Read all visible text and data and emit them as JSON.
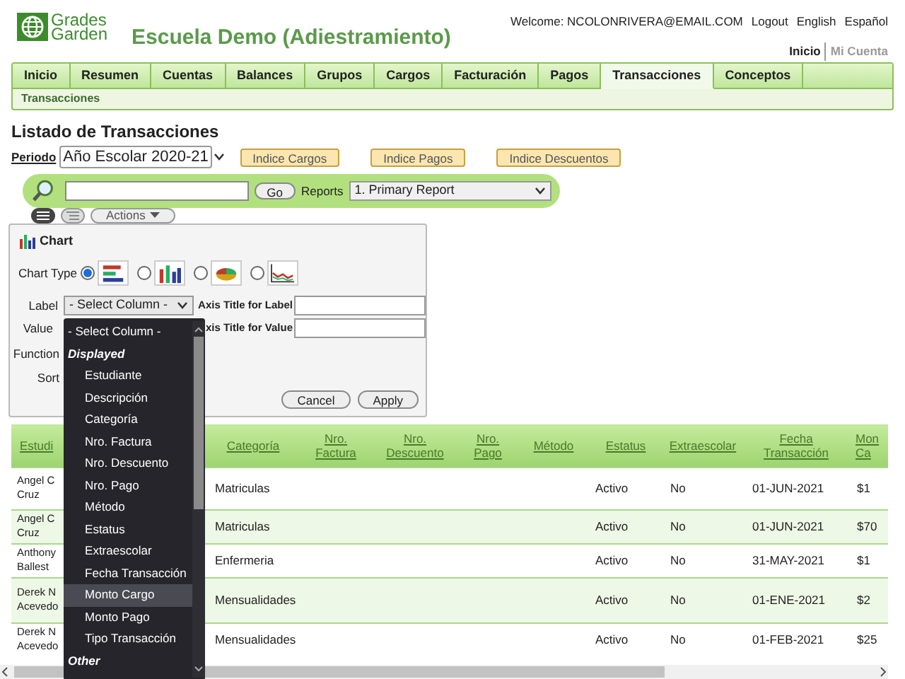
{
  "header": {
    "logo_top": "Grades",
    "logo_bottom": "Garden",
    "school": "Escuela Demo (Adiestramiento)",
    "welcome": "Welcome: NCOLONRIVERA@EMAIL.COM",
    "links": [
      "Logout",
      "English",
      "Español"
    ],
    "account_links": [
      {
        "label": "Inicio",
        "selected": true
      },
      {
        "label": "Mi Cuenta",
        "selected": false
      }
    ]
  },
  "nav": {
    "tabs": [
      {
        "label": "Inicio",
        "selected": false
      },
      {
        "label": "Resumen",
        "selected": false
      },
      {
        "label": "Cuentas",
        "selected": false
      },
      {
        "label": "Balances",
        "selected": false
      },
      {
        "label": "Grupos",
        "selected": false
      },
      {
        "label": "Cargos",
        "selected": false
      },
      {
        "label": "Facturación",
        "selected": false
      },
      {
        "label": "Pagos",
        "selected": false
      },
      {
        "label": "Transacciones",
        "selected": true
      },
      {
        "label": "Conceptos",
        "selected": false
      }
    ],
    "subtab": "Transacciones"
  },
  "page_title": "Listado de Transacciones",
  "period": {
    "label": "Periodo",
    "value": "Año Escolar 2020-21"
  },
  "index_buttons": [
    "Indice Cargos",
    "Indice Pagos",
    "Indice Descuentos"
  ],
  "search": {
    "go": "Go",
    "reports_label": "Reports",
    "report": "1. Primary Report"
  },
  "toolbar": {
    "actions": "Actions"
  },
  "chart_panel": {
    "title": "Chart",
    "chart_type_label": "Chart Type",
    "chart_types": [
      {
        "kind": "bar_horizontal",
        "selected": true
      },
      {
        "kind": "bar_vertical",
        "selected": false
      },
      {
        "kind": "pie",
        "selected": false
      },
      {
        "kind": "line",
        "selected": false
      }
    ],
    "label_row": {
      "label": "Label",
      "select": "- Select Column -",
      "axis_label": "Axis Title for Label"
    },
    "value_row": {
      "label": "Value",
      "axis_label": "xis Title for Value"
    },
    "function_label": "Function",
    "sort_label": "Sort",
    "buttons": [
      "Cancel",
      "Apply"
    ]
  },
  "dropdown": {
    "items": [
      {
        "kind": "option",
        "label": "- Select Column -",
        "highlighted": false
      },
      {
        "kind": "group",
        "label": "Displayed",
        "highlighted": false
      },
      {
        "kind": "sub",
        "label": "Estudiante",
        "highlighted": false
      },
      {
        "kind": "sub",
        "label": "Descripción",
        "highlighted": false
      },
      {
        "kind": "sub",
        "label": "Categoría",
        "highlighted": false
      },
      {
        "kind": "sub",
        "label": "Nro. Factura",
        "highlighted": false
      },
      {
        "kind": "sub",
        "label": "Nro. Descuento",
        "highlighted": false
      },
      {
        "kind": "sub",
        "label": "Nro. Pago",
        "highlighted": false
      },
      {
        "kind": "sub",
        "label": "Método",
        "highlighted": false
      },
      {
        "kind": "sub",
        "label": "Estatus",
        "highlighted": false
      },
      {
        "kind": "sub",
        "label": "Extraescolar",
        "highlighted": false
      },
      {
        "kind": "sub",
        "label": "Fecha Transacción",
        "highlighted": false
      },
      {
        "kind": "sub",
        "label": "Monto Cargo",
        "highlighted": true
      },
      {
        "kind": "sub",
        "label": "Monto Pago",
        "highlighted": false
      },
      {
        "kind": "sub",
        "label": "Tipo Transacción",
        "highlighted": false
      },
      {
        "kind": "group",
        "label": "Other",
        "highlighted": false
      }
    ]
  },
  "table": {
    "columns": [
      [
        "Estudi"
      ],
      [],
      [
        "Categoría"
      ],
      [
        "Nro.",
        "Factura"
      ],
      [
        "Nro.",
        "Descuento"
      ],
      [
        "Nro.",
        "Pago"
      ],
      [
        "Método"
      ],
      [
        "Estatus"
      ],
      [
        "Extraescolar"
      ],
      [
        "Fecha",
        "Transacción"
      ],
      [
        "Mon",
        "Ca"
      ]
    ],
    "rows": [
      {
        "student": [
          "Angel C",
          "Cruz"
        ],
        "categoria": "Matriculas",
        "estatus": "Activo",
        "extraescolar": "No",
        "fecha": "01-JUN-2021",
        "monto": "$1"
      },
      {
        "student": [
          "Angel C",
          "Cruz"
        ],
        "categoria": "Matriculas",
        "estatus": "Activo",
        "extraescolar": "No",
        "fecha": "01-JUN-2021",
        "monto": "$70"
      },
      {
        "student": [
          "Anthony",
          "Ballest"
        ],
        "categoria": "Enfermeria",
        "estatus": "Activo",
        "extraescolar": "No",
        "fecha": "31-MAY-2021",
        "monto": "$1"
      },
      {
        "student": [
          "Derek N",
          "Acevedo"
        ],
        "categoria": "Mensualidades",
        "estatus": "Activo",
        "extraescolar": "No",
        "fecha": "01-ENE-2021",
        "monto": "$2"
      },
      {
        "student": [
          "Derek N",
          "Acevedo"
        ],
        "categoria": "Mensualidades",
        "estatus": "Activo",
        "extraescolar": "No",
        "fecha": "01-FEB-2021",
        "monto": "$25"
      }
    ]
  }
}
